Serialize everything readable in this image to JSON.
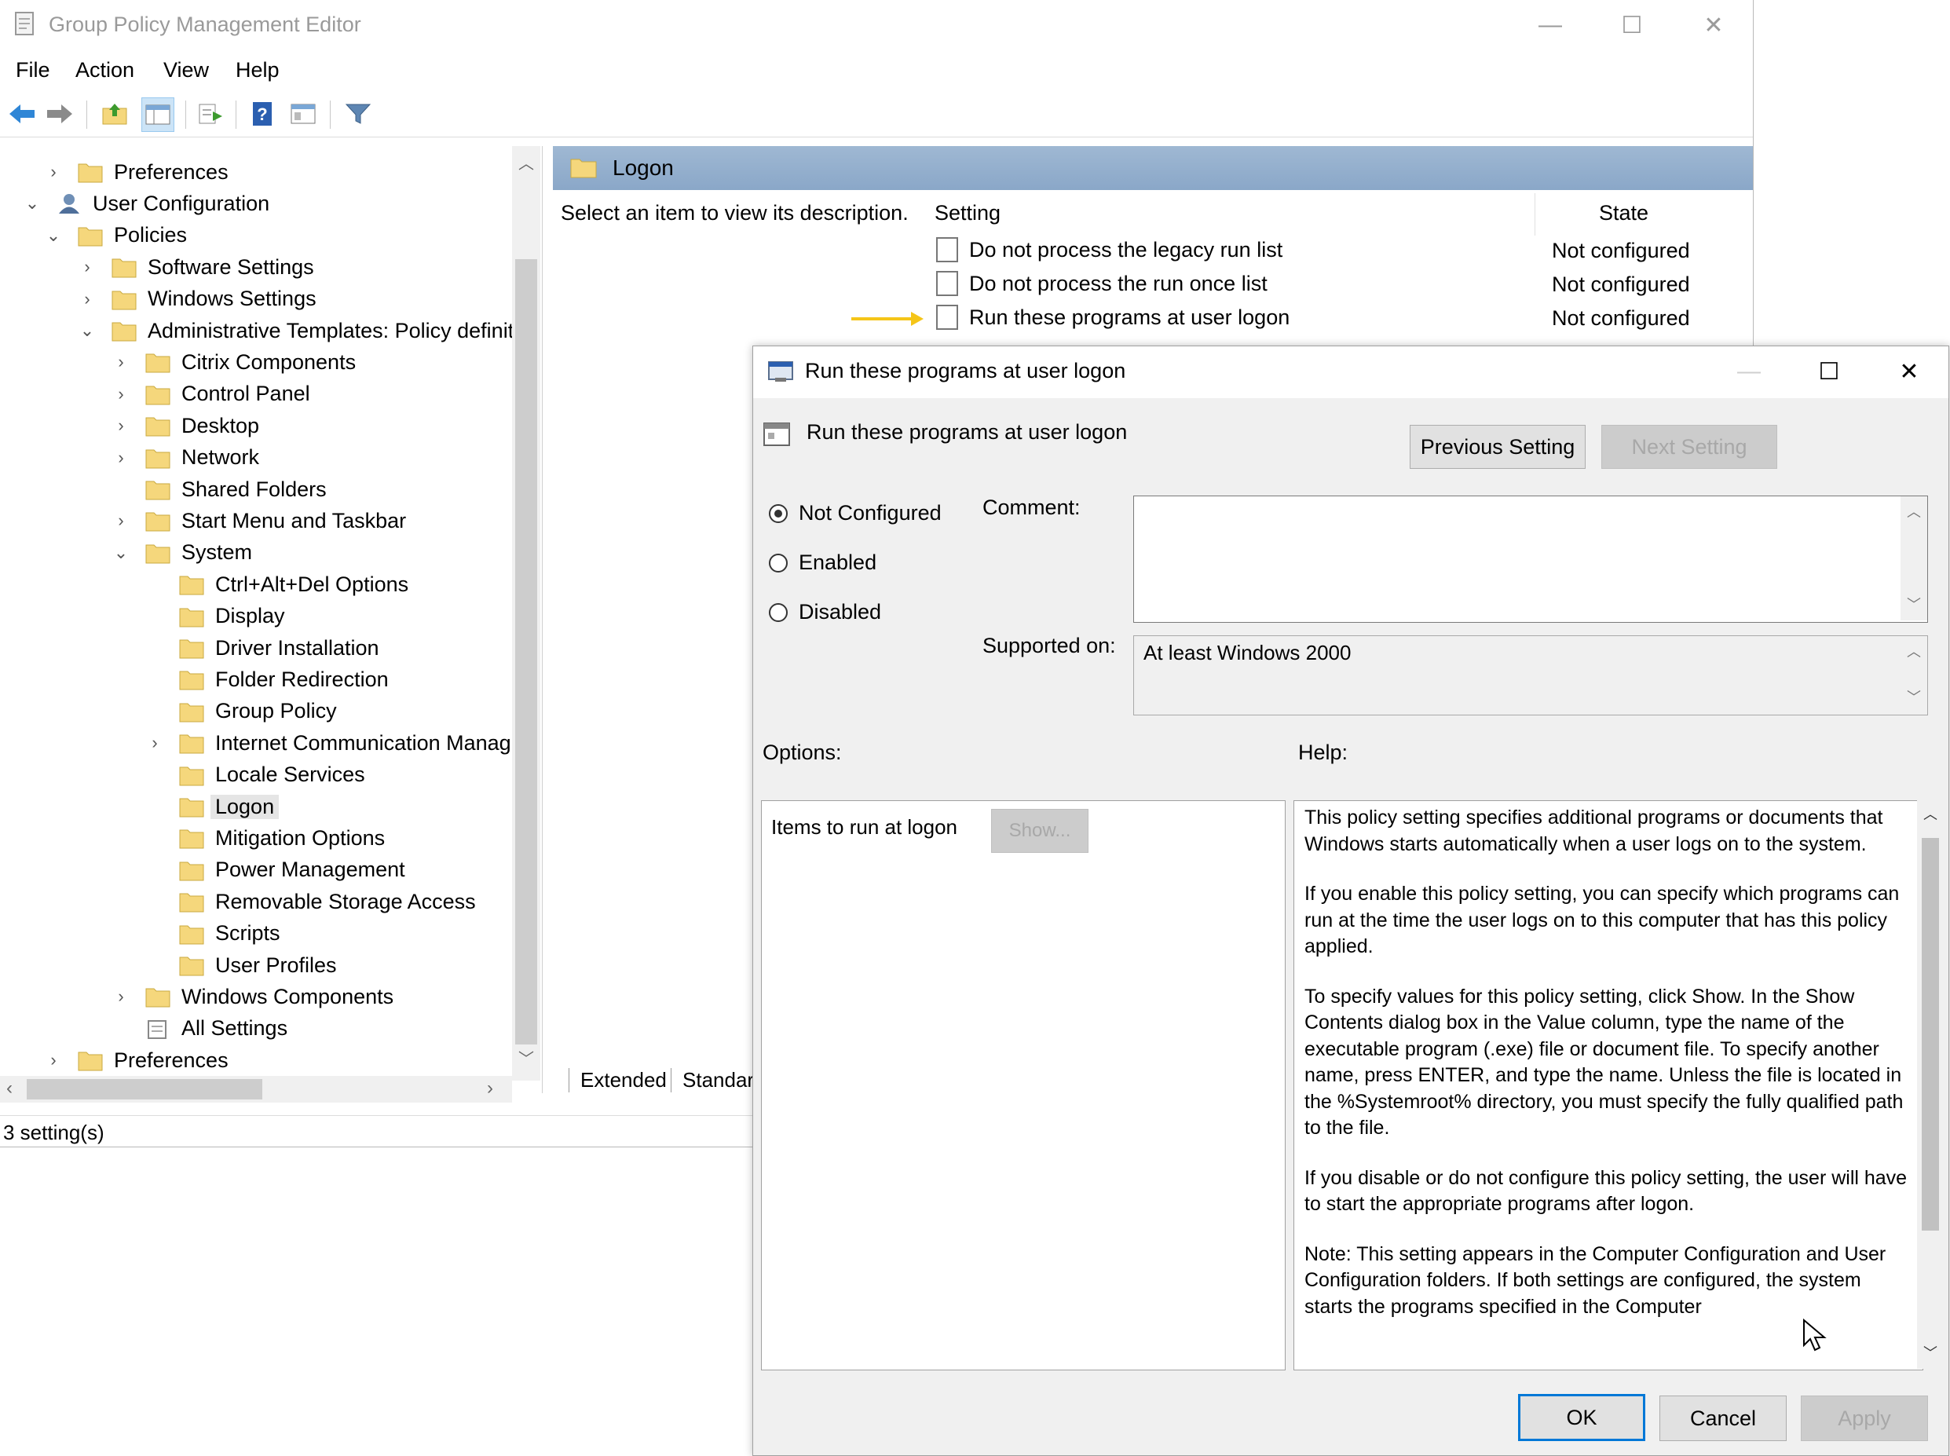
{
  "window": {
    "title": "Group Policy Management Editor",
    "controls": {
      "minimize": "—",
      "maximize": "☐",
      "close": "✕"
    }
  },
  "menu": [
    "File",
    "Action",
    "View",
    "Help"
  ],
  "toolbar": {
    "icons": [
      "back-arrow",
      "forward-arrow",
      "up-folder",
      "show-hide-tree",
      "export-list",
      "help",
      "properties",
      "filter"
    ]
  },
  "tree": {
    "items": [
      {
        "label": "Preferences",
        "expander": ">"
      },
      {
        "label": "User Configuration",
        "expander": "v"
      },
      {
        "label": "Policies",
        "expander": "v"
      },
      {
        "label": "Software Settings",
        "expander": ">"
      },
      {
        "label": "Windows Settings",
        "expander": ">"
      },
      {
        "label": "Administrative Templates: Policy definit",
        "expander": "v"
      },
      {
        "label": "Citrix Components",
        "expander": ">"
      },
      {
        "label": "Control Panel",
        "expander": ">"
      },
      {
        "label": "Desktop",
        "expander": ">"
      },
      {
        "label": "Network",
        "expander": ">"
      },
      {
        "label": "Shared Folders",
        "expander": ""
      },
      {
        "label": "Start Menu and Taskbar",
        "expander": ">"
      },
      {
        "label": "System",
        "expander": "v"
      },
      {
        "label": "Ctrl+Alt+Del Options",
        "expander": ""
      },
      {
        "label": "Display",
        "expander": ""
      },
      {
        "label": "Driver Installation",
        "expander": ""
      },
      {
        "label": "Folder Redirection",
        "expander": ""
      },
      {
        "label": "Group Policy",
        "expander": ""
      },
      {
        "label": "Internet Communication Manag",
        "expander": ">"
      },
      {
        "label": "Locale Services",
        "expander": ""
      },
      {
        "label": "Logon",
        "expander": ""
      },
      {
        "label": "Mitigation Options",
        "expander": ""
      },
      {
        "label": "Power Management",
        "expander": ""
      },
      {
        "label": "Removable Storage Access",
        "expander": ""
      },
      {
        "label": "Scripts",
        "expander": ""
      },
      {
        "label": "User Profiles",
        "expander": ""
      },
      {
        "label": "Windows Components",
        "expander": ">"
      },
      {
        "label": "All Settings",
        "expander": ""
      },
      {
        "label": "Preferences",
        "expander": ">"
      }
    ],
    "selected": "Logon"
  },
  "right_pane": {
    "header": "Logon",
    "description": "Select an item to view its description.",
    "columns": {
      "setting": "Setting",
      "state": "State"
    },
    "rows": [
      {
        "setting": "Do not process the legacy run list",
        "state": "Not configured"
      },
      {
        "setting": "Do not process the run once list",
        "state": "Not configured"
      },
      {
        "setting": "Run these programs at user logon",
        "state": "Not configured"
      }
    ],
    "tabs": [
      "Extended",
      "Standar"
    ]
  },
  "status": "3 setting(s)",
  "dialog": {
    "title": "Run these programs at user logon",
    "setting_name": "Run these programs at user logon",
    "prev_button": "Previous Setting",
    "next_button": "Next Setting",
    "radios": [
      {
        "label": "Not Configured",
        "checked": true
      },
      {
        "label": "Enabled",
        "checked": false
      },
      {
        "label": "Disabled",
        "checked": false
      }
    ],
    "comment_label": "Comment:",
    "comment_value": "",
    "supported_label": "Supported on:",
    "supported_value": "At least Windows 2000",
    "options_label": "Options:",
    "help_label": "Help:",
    "options_item_label": "Items to run at logon",
    "show_button": "Show...",
    "help_paragraphs": [
      "This policy setting specifies additional programs or documents that Windows starts automatically when a user logs on to the system.",
      "If you enable this policy setting, you can specify which programs can run at the time the user logs on to this computer that has this policy applied.",
      "To specify values for this policy setting, click Show. In the Show Contents dialog box in the Value column, type the name of the executable program (.exe) file or document file. To specify another name, press ENTER, and type the name. Unless the file is located in the %Systemroot% directory, you must specify the fully qualified path to the file.",
      "If you disable or do not configure this policy setting, the user will have to start the appropriate programs after logon.",
      "Note: This setting appears in the Computer Configuration and User Configuration folders. If both settings are configured, the system starts the programs specified in the Computer"
    ],
    "ok_button": "OK",
    "cancel_button": "Cancel",
    "apply_button": "Apply"
  },
  "colors": {
    "folder": "#f5d77c",
    "pane_header": "#9bb5d1",
    "arrow": "#f5c518",
    "accent": "#0078d7"
  }
}
